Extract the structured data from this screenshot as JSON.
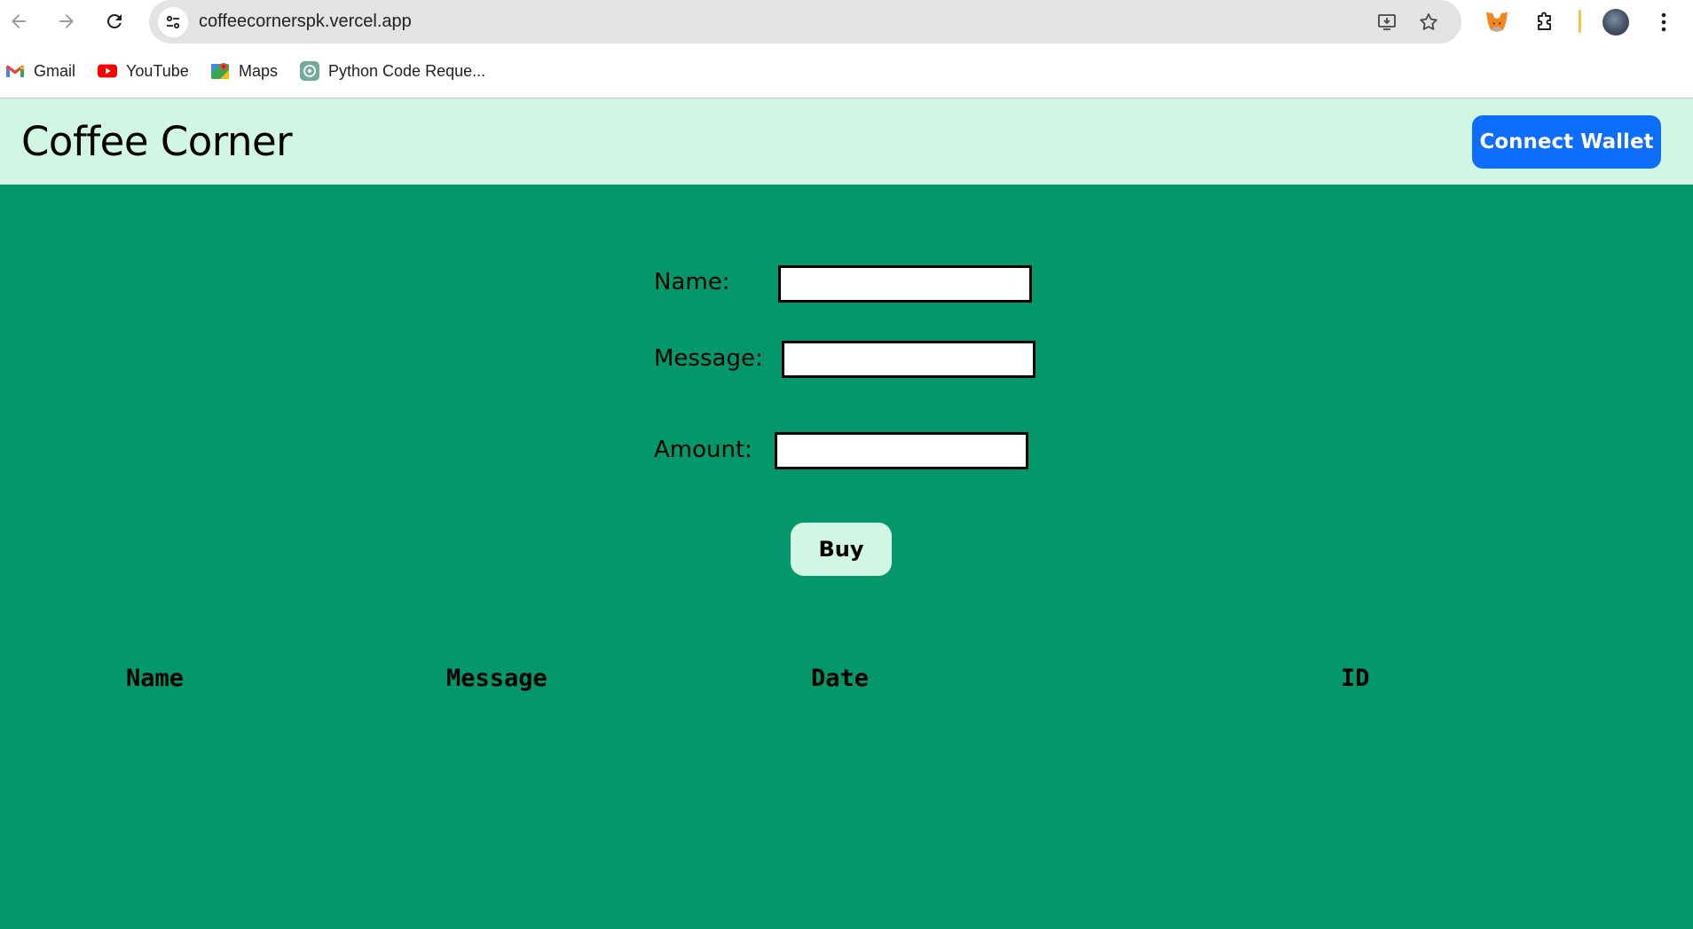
{
  "browser": {
    "url": "coffeecornerspk.vercel.app",
    "bookmarks": [
      {
        "label": "Gmail",
        "icon": "gmail-icon"
      },
      {
        "label": "YouTube",
        "icon": "youtube-icon"
      },
      {
        "label": "Maps",
        "icon": "maps-icon"
      },
      {
        "label": "Python Code Reque...",
        "icon": "chatgpt-icon"
      }
    ]
  },
  "header": {
    "title": "Coffee Corner",
    "connect_label": "Connect Wallet"
  },
  "form": {
    "name_label": "Name:",
    "name_value": "",
    "message_label": "Message:",
    "message_value": "",
    "amount_label": "Amount:",
    "amount_value": "",
    "buy_label": "Buy"
  },
  "table": {
    "headers": [
      "Name",
      "Message",
      "Date",
      "ID"
    ],
    "rows": []
  },
  "colors": {
    "header_bg": "#d1f7e4",
    "main_bg": "#04976b",
    "accent_button": "#0d6efd"
  }
}
